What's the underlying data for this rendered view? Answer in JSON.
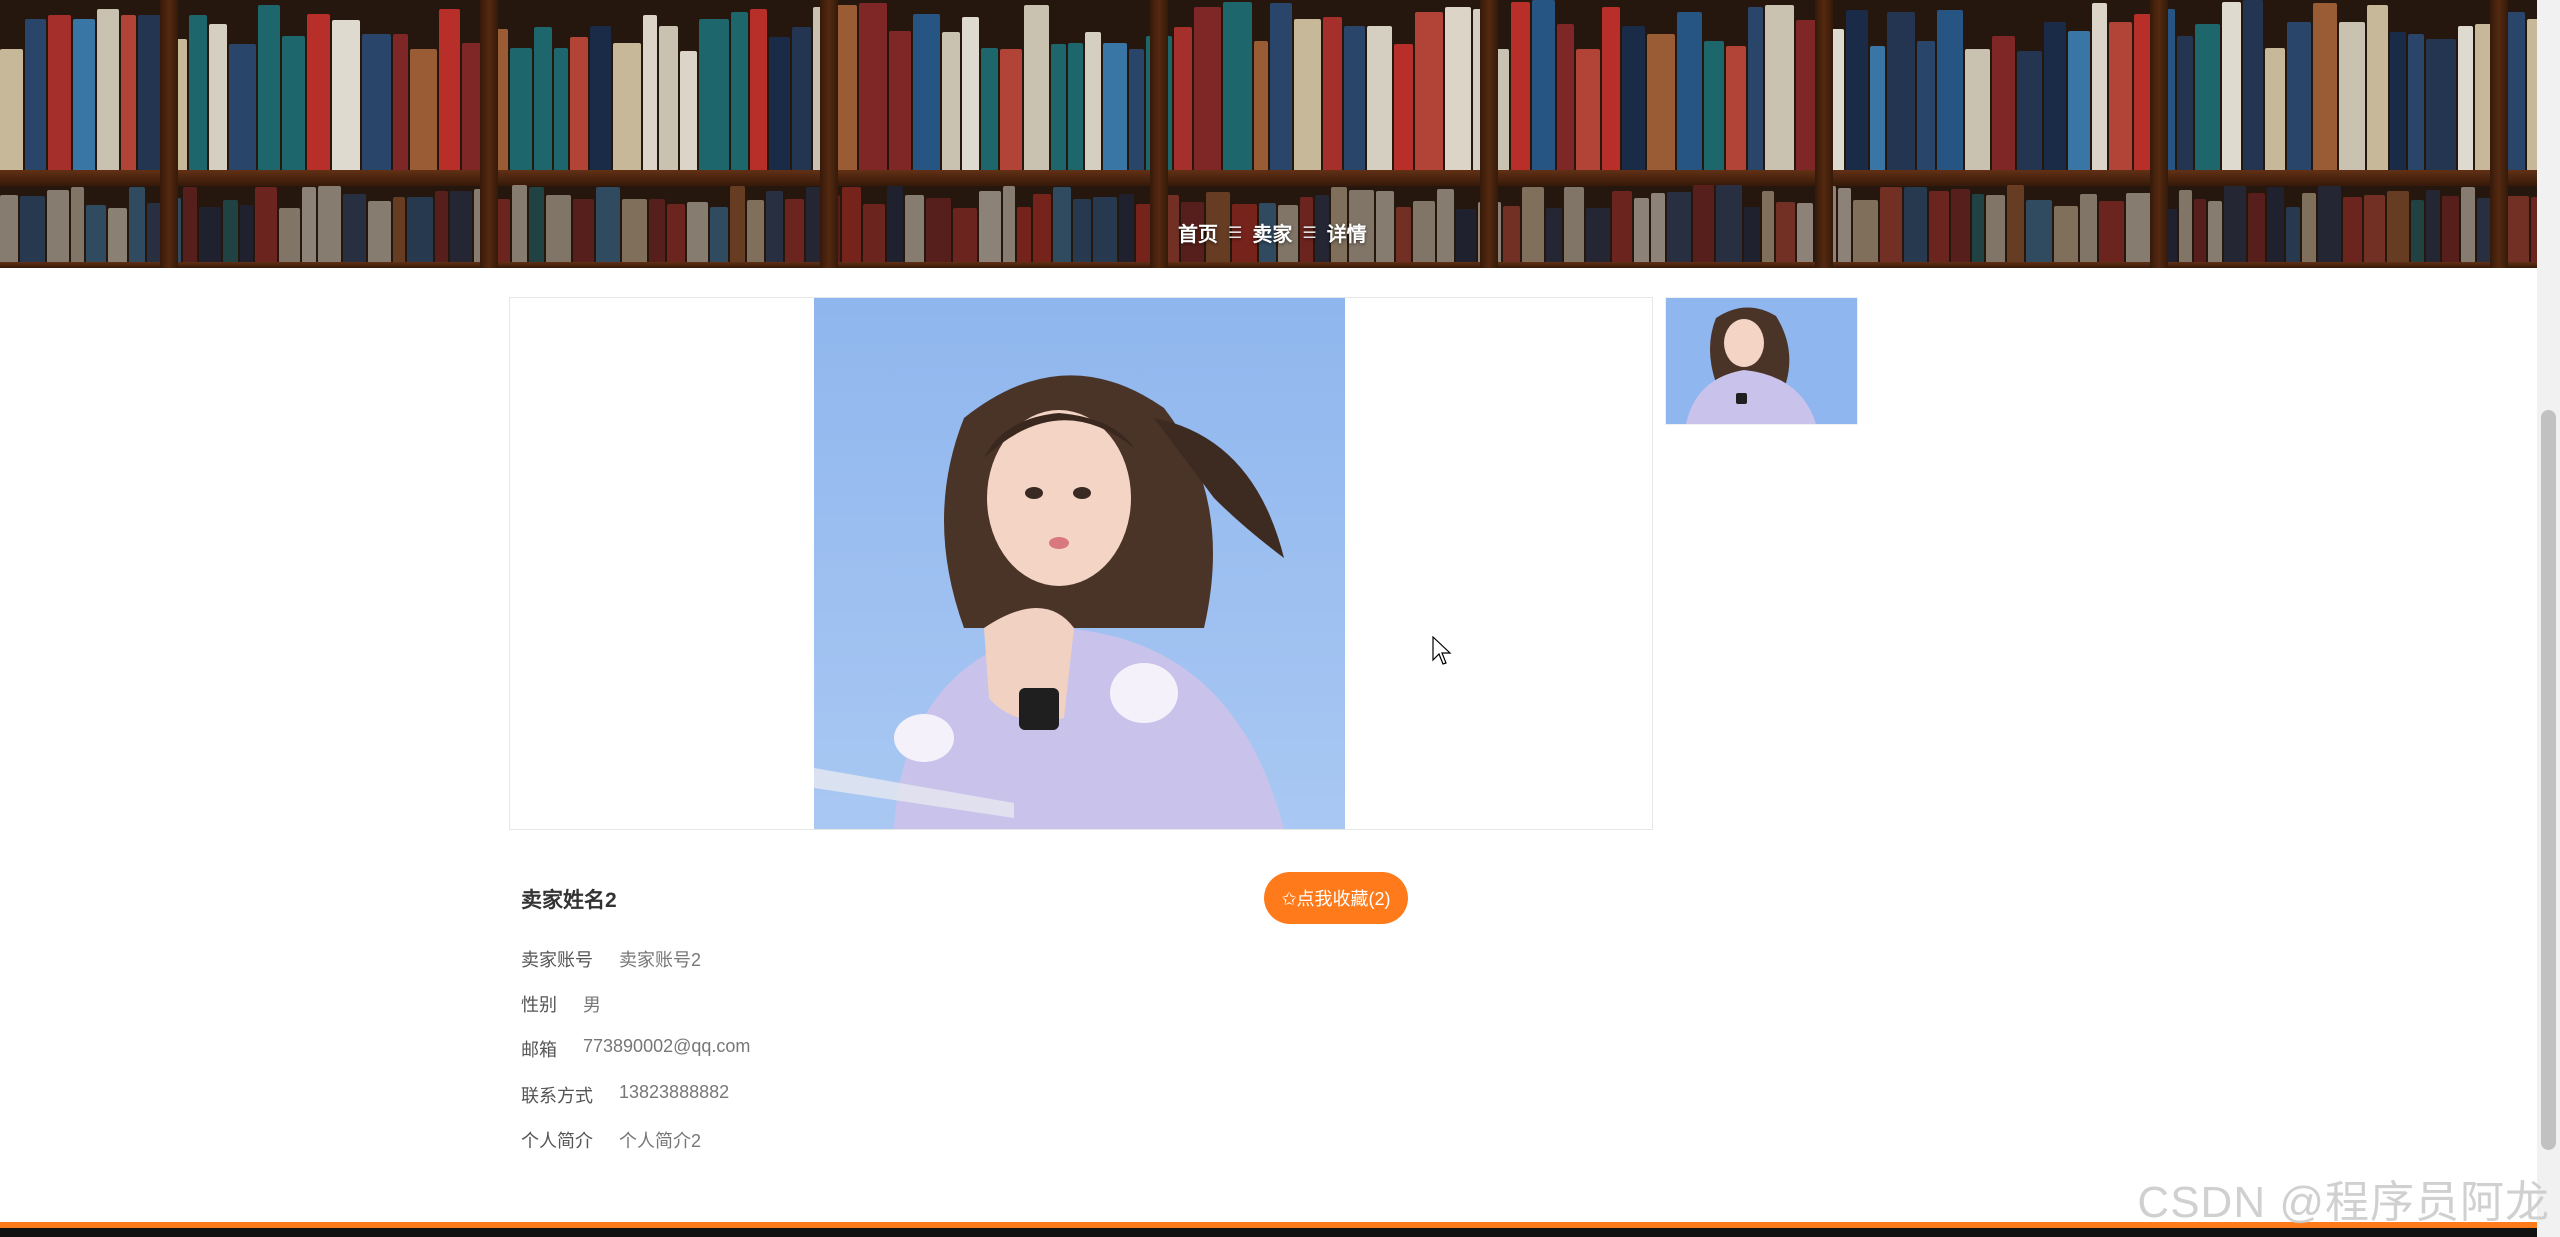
{
  "breadcrumb": {
    "home": "首页",
    "section": "卖家",
    "current": "详情",
    "separator": "☰"
  },
  "seller": {
    "name": "卖家姓名2",
    "favorite_button": "✩点我收藏(2)",
    "fields": [
      {
        "label": "卖家账号",
        "value": "卖家账号2"
      },
      {
        "label": "性别",
        "value": "男"
      },
      {
        "label": "邮箱",
        "value": "773890002@qq.com"
      },
      {
        "label": "联系方式",
        "value": "13823888882"
      },
      {
        "label": "个人简介",
        "value": "个人简介2"
      }
    ]
  },
  "watermark": "CSDN @程序员阿龙",
  "colors": {
    "accent": "#ff7a1a",
    "photo_sky": "#8fb6ee"
  }
}
